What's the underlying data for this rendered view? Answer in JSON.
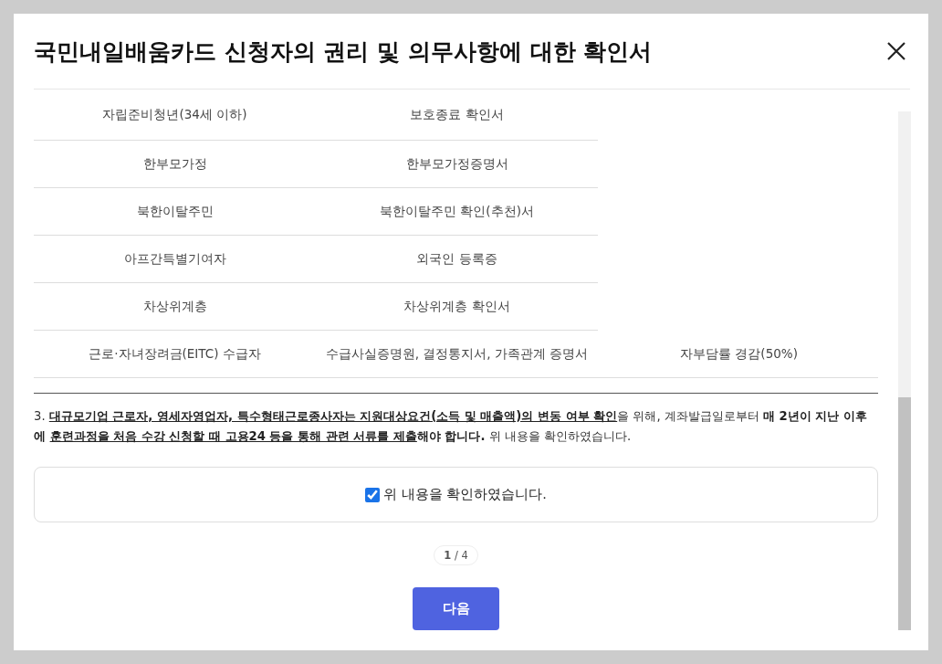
{
  "dialog": {
    "title": "국민내일배움카드 신청자의 권리 및 의무사항에 대한 확인서"
  },
  "table": {
    "rows": [
      {
        "cells": [
          "자립준비청년(34세 이하)",
          "보호종료 확인서"
        ]
      },
      {
        "cells": [
          "한부모가정",
          "한부모가정증명서"
        ]
      },
      {
        "cells": [
          "북한이탈주민",
          "북한이탈주민 확인(추천)서"
        ]
      },
      {
        "cells": [
          "아프간특별기여자",
          "외국인 등록증"
        ]
      },
      {
        "cells": [
          "차상위계층",
          "차상위계층 확인서"
        ]
      },
      {
        "cells": [
          "근로·자녀장려금(EITC) 수급자",
          "수급사실증명원, 결정통지서, 가족관계 증명서",
          "자부담률 경감(50%)"
        ]
      }
    ]
  },
  "notice": {
    "segments": [
      {
        "text": "3. ",
        "bold": false,
        "underline": false
      },
      {
        "text": "대규모기업 근로자, 영세자영업자, 특수형태근로종사자는 지원대상요건(소득 및 매출액)의 변동 여부 확인",
        "bold": true,
        "underline": true
      },
      {
        "text": "을 위해, 계좌발급일로부터 ",
        "bold": false,
        "underline": false
      },
      {
        "text": "매 2년이 지난 이후에 ",
        "bold": true,
        "underline": false
      },
      {
        "text": "훈련과정을 처음 수강 신청할 때 고용24 등을 통해 관련 서류를 제출",
        "bold": true,
        "underline": true
      },
      {
        "text": "해야 합니다.",
        "bold": true,
        "underline": false
      },
      {
        "text": " 위 내용을 확인하였습니다.",
        "bold": false,
        "underline": false
      }
    ]
  },
  "confirm": {
    "label": "위 내용을 확인하였습니다.",
    "checked": true
  },
  "pager": {
    "current": "1",
    "separator": "/",
    "total": "4"
  },
  "buttons": {
    "next": "다음"
  }
}
